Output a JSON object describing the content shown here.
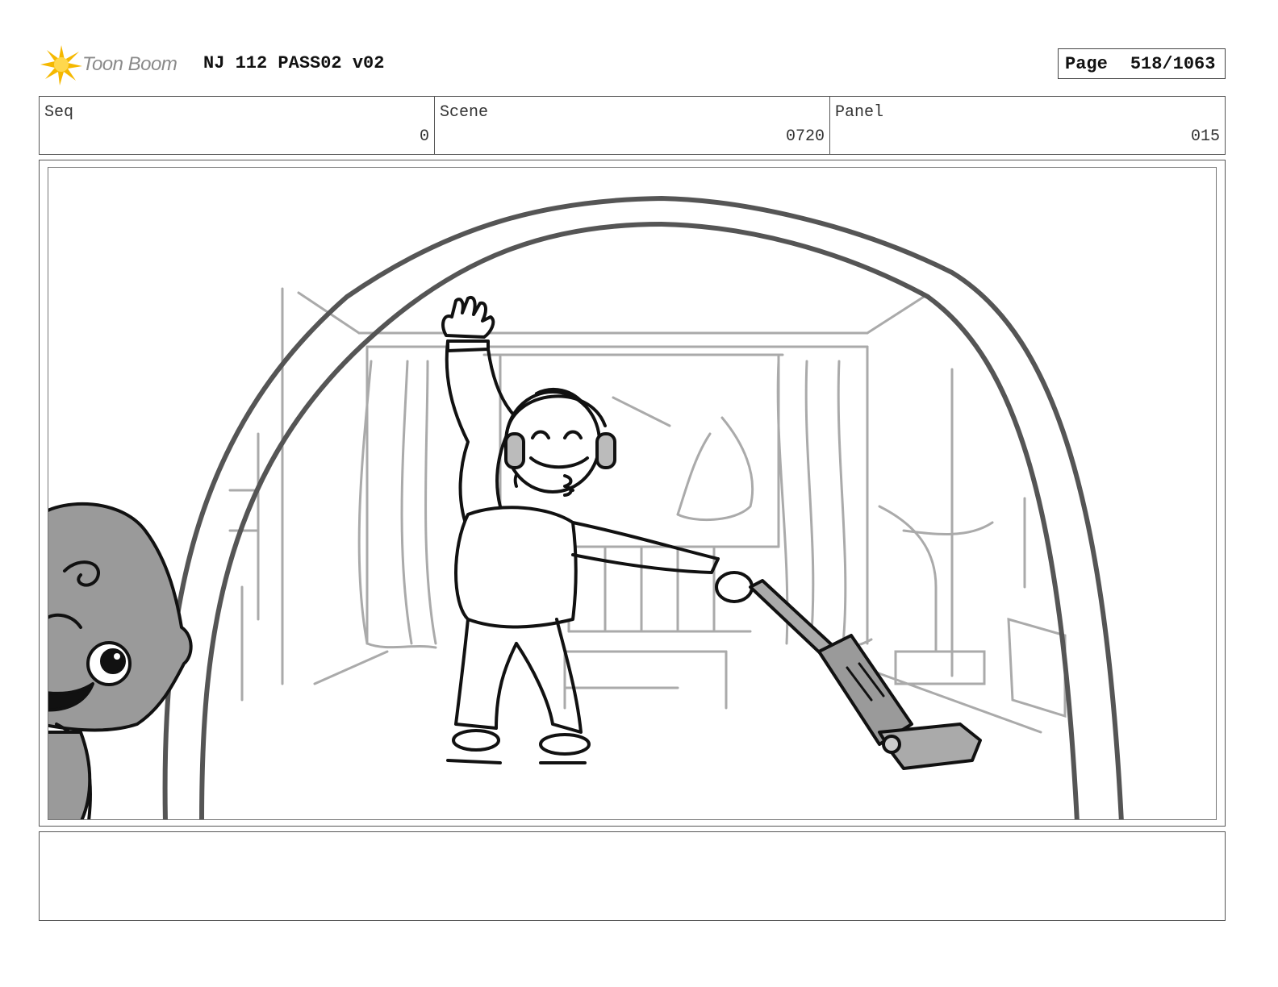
{
  "header": {
    "logo_text": "Toon Boom",
    "title": "NJ 112 PASS02 v02",
    "page_label": "Page",
    "page_value": "518/1063"
  },
  "meta": {
    "seq_label": "Seq",
    "seq_value": "0",
    "scene_label": "Scene",
    "scene_value": "0720",
    "panel_label": "Panel",
    "panel_value": "015"
  },
  "panel": {
    "description": ""
  },
  "notes": {
    "text": ""
  },
  "colors": {
    "logo_yellow": "#f5b800",
    "logo_text": "#8a8a8a",
    "border": "#555555",
    "sketch_dark": "#111111",
    "sketch_mid": "#555555",
    "sketch_light": "#aaaaaa",
    "fill_gray": "#9a9a9a"
  }
}
